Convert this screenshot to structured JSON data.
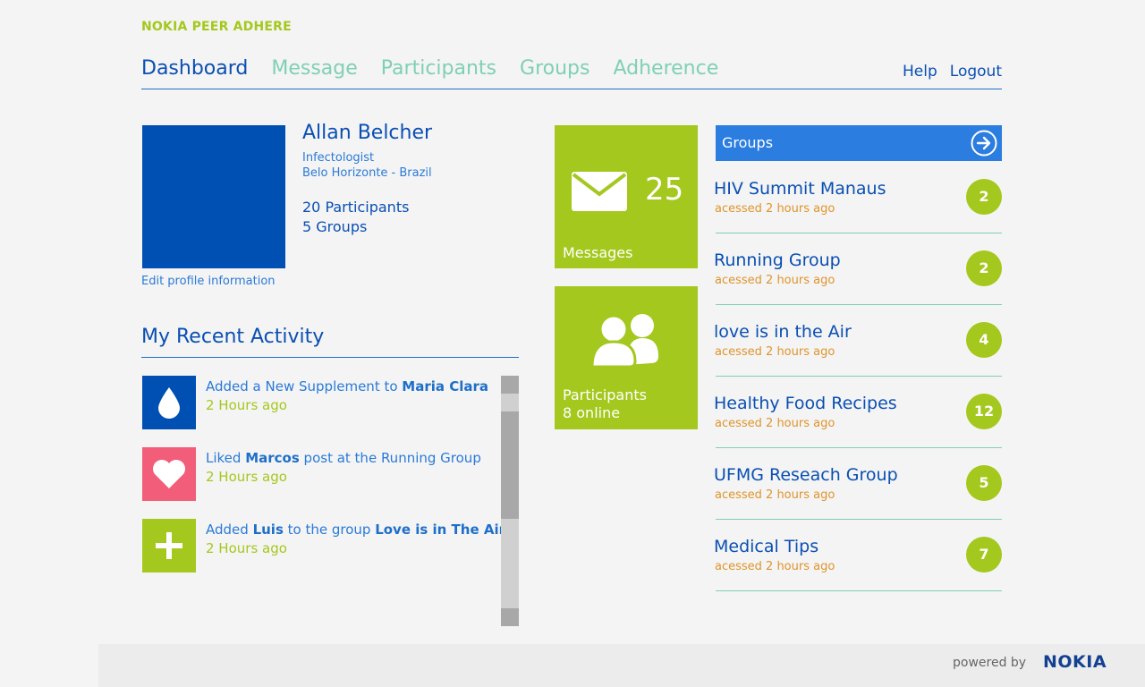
{
  "app": {
    "title": "NOKIA PEER ADHERE"
  },
  "nav": {
    "items": [
      {
        "label": "Dashboard",
        "active": true
      },
      {
        "label": "Message",
        "active": false
      },
      {
        "label": "Participants",
        "active": false
      },
      {
        "label": "Groups",
        "active": false
      },
      {
        "label": "Adherence",
        "active": false
      }
    ],
    "help": "Help",
    "logout": "Logout"
  },
  "profile": {
    "name": "Allan Belcher",
    "role": "Infectologist",
    "location": "Belo Horizonte - Brazil",
    "participants": "20 Participants",
    "groups": "5 Groups",
    "edit_link": "Edit profile information",
    "avatar_color": "#0050b3"
  },
  "activity": {
    "title": "My Recent Activity",
    "items": [
      {
        "icon": "drop-icon",
        "color": "#0050b3",
        "prefix": "Added a New Supplement to ",
        "bold1": "Maria Clara",
        "middle": "",
        "bold2": "",
        "time": "2 Hours ago"
      },
      {
        "icon": "heart-icon",
        "color": "#f25d7a",
        "prefix": "Liked ",
        "bold1": "Marcos",
        "middle": " post at the Running Group",
        "bold2": "",
        "time": "2 Hours ago"
      },
      {
        "icon": "plus-icon",
        "color": "#a4c81d",
        "prefix": "Added ",
        "bold1": "Luis",
        "middle": " to the group ",
        "bold2": "Love is in The Air",
        "time": "2 Hours ago"
      }
    ]
  },
  "tiles": {
    "messages": {
      "count": "25",
      "label": "Messages",
      "icon": "envelope-icon"
    },
    "participants": {
      "label": "Participants",
      "sub": "8 online",
      "icon": "people-icon"
    },
    "color": "#a4c81d"
  },
  "groups": {
    "title": "Groups",
    "items": [
      {
        "name": "HIV Summit Manaus",
        "time": "acessed 2 hours ago",
        "count": "2"
      },
      {
        "name": "Running Group",
        "time": "acessed 2 hours ago",
        "count": "2"
      },
      {
        "name": "love is in the Air",
        "time": "acessed 2 hours ago",
        "count": "4"
      },
      {
        "name": "Healthy Food Recipes",
        "time": "acessed 2 hours ago",
        "count": "12"
      },
      {
        "name": "UFMG Reseach Group",
        "time": "acessed 2 hours ago",
        "count": "5"
      },
      {
        "name": "Medical Tips",
        "time": "acessed 2 hours ago",
        "count": "7"
      }
    ]
  },
  "footer": {
    "powered_by": "powered by",
    "logo": "NOKIA"
  }
}
